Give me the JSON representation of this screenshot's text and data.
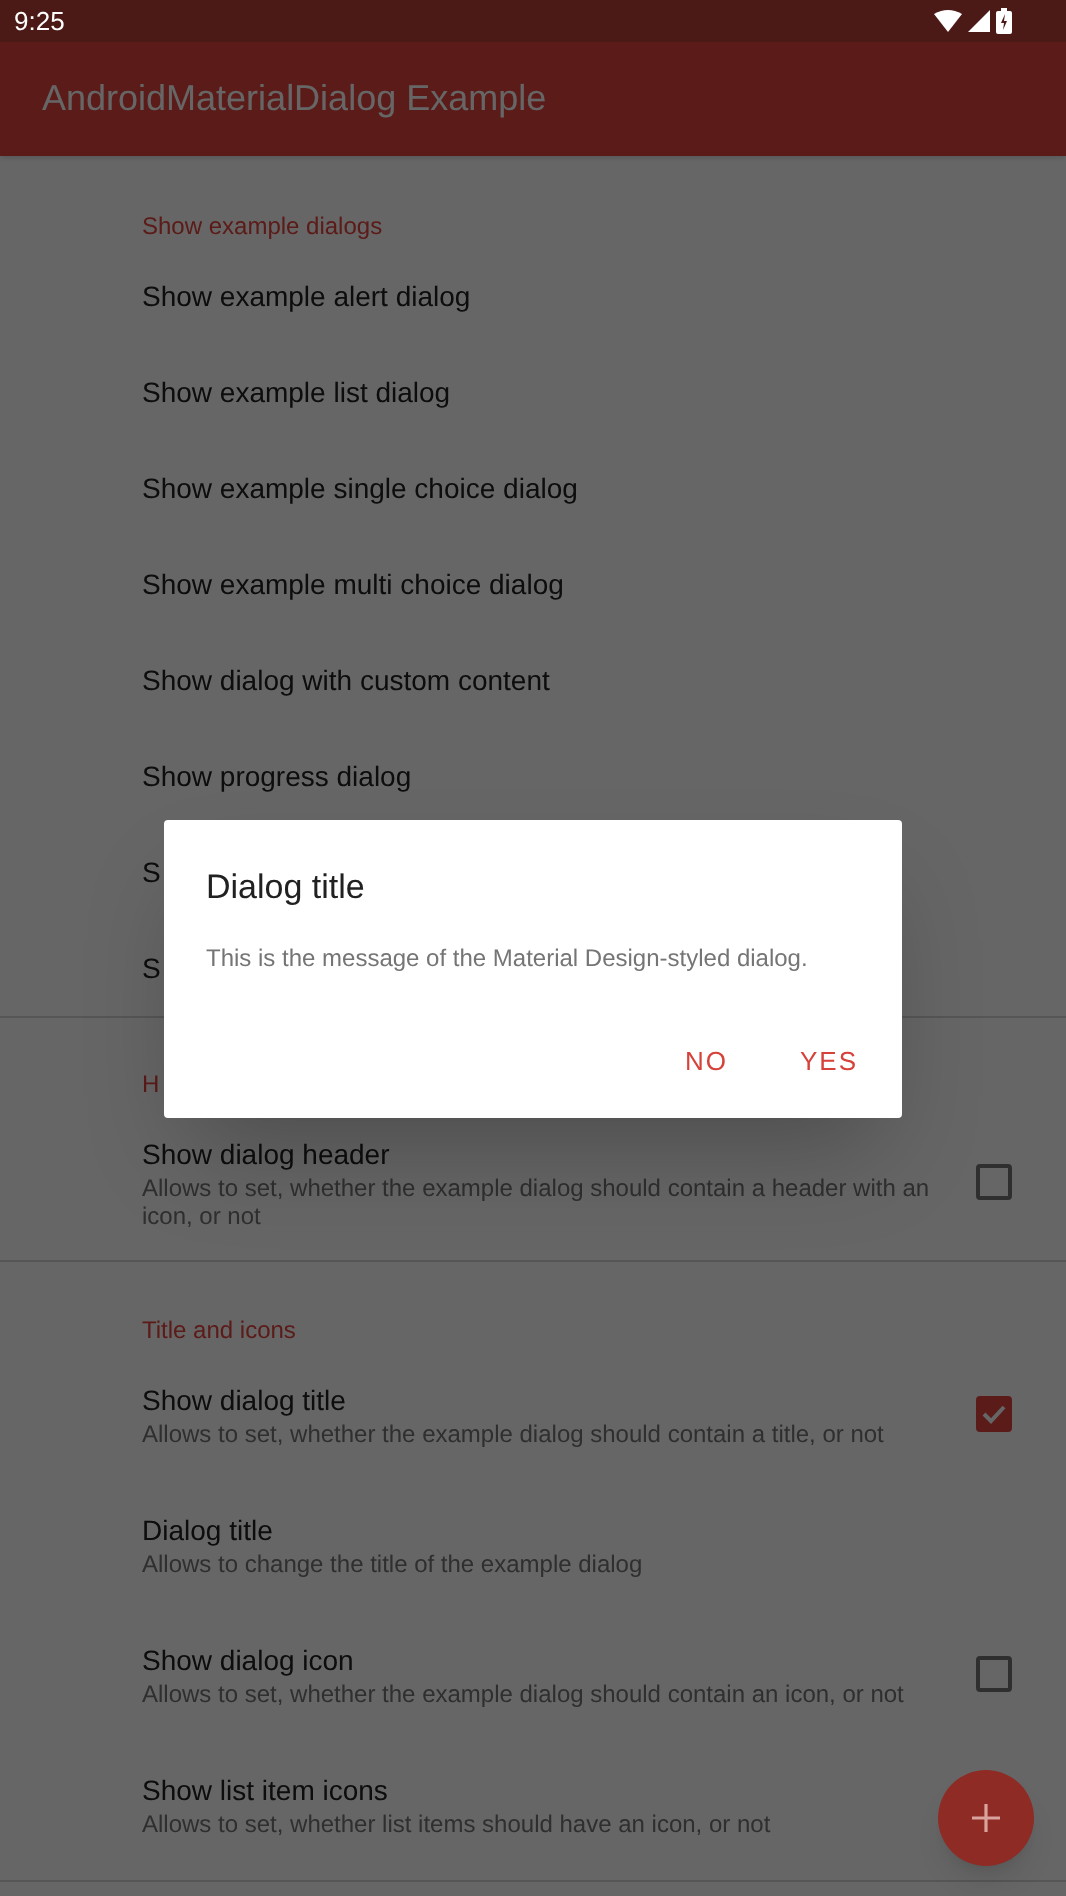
{
  "status_bar": {
    "time": "9:25"
  },
  "toolbar": {
    "title": "AndroidMaterialDialog Example"
  },
  "sections": [
    {
      "title": "Show example dialogs",
      "items": [
        {
          "kind": "action",
          "title": "Show example alert dialog"
        },
        {
          "kind": "action",
          "title": "Show example list dialog"
        },
        {
          "kind": "action",
          "title": "Show example single choice dialog"
        },
        {
          "kind": "action",
          "title": "Show example multi choice dialog"
        },
        {
          "kind": "action",
          "title": "Show dialog with custom content"
        },
        {
          "kind": "action",
          "title": "Show progress dialog"
        },
        {
          "kind": "action",
          "title": "S"
        },
        {
          "kind": "action",
          "title": "S"
        }
      ]
    },
    {
      "title": "H",
      "items": [
        {
          "kind": "checkbox",
          "title": "Show dialog header",
          "summary": "Allows to set, whether the example dialog should contain a header with an icon, or not",
          "checked": false
        }
      ]
    },
    {
      "title": "Title and icons",
      "items": [
        {
          "kind": "checkbox",
          "title": "Show dialog title",
          "summary": "Allows to set, whether the example dialog should contain a title, or not",
          "checked": true
        },
        {
          "kind": "text",
          "title": "Dialog title",
          "summary": "Allows to change the title of the example dialog"
        },
        {
          "kind": "checkbox",
          "title": "Show dialog icon",
          "summary": "Allows to set, whether the example dialog should contain an icon, or not",
          "checked": false
        },
        {
          "kind": "text",
          "title": "Show list item icons",
          "summary": "Allows to set, whether list items should have an icon, or not"
        }
      ]
    }
  ],
  "dialog": {
    "title": "Dialog title",
    "message": "This is the message of the Material Design-styled dialog.",
    "buttons": [
      "NO",
      "YES"
    ]
  }
}
